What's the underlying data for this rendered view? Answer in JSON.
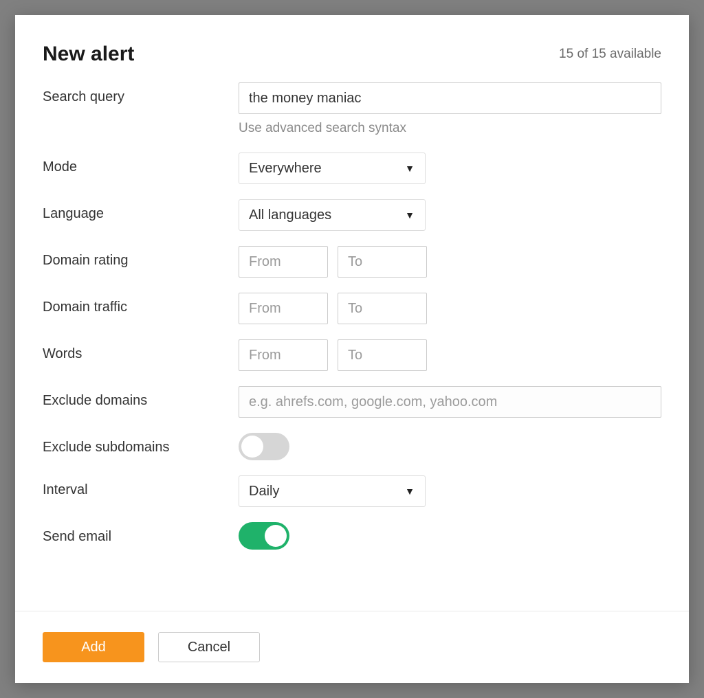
{
  "header": {
    "title": "New alert",
    "availability": "15 of 15 available"
  },
  "form": {
    "search_query": {
      "label": "Search query",
      "value": "the money maniac",
      "hint": "Use advanced search syntax"
    },
    "mode": {
      "label": "Mode",
      "value": "Everywhere"
    },
    "language": {
      "label": "Language",
      "value": "All languages"
    },
    "domain_rating": {
      "label": "Domain rating",
      "from_placeholder": "From",
      "to_placeholder": "To"
    },
    "domain_traffic": {
      "label": "Domain traffic",
      "from_placeholder": "From",
      "to_placeholder": "To"
    },
    "words": {
      "label": "Words",
      "from_placeholder": "From",
      "to_placeholder": "To"
    },
    "exclude_domains": {
      "label": "Exclude domains",
      "placeholder": "e.g. ahrefs.com, google.com, yahoo.com"
    },
    "exclude_subdomains": {
      "label": "Exclude subdomains",
      "value": false
    },
    "interval": {
      "label": "Interval",
      "value": "Daily"
    },
    "send_email": {
      "label": "Send email",
      "value": true
    }
  },
  "footer": {
    "add_label": "Add",
    "cancel_label": "Cancel"
  }
}
